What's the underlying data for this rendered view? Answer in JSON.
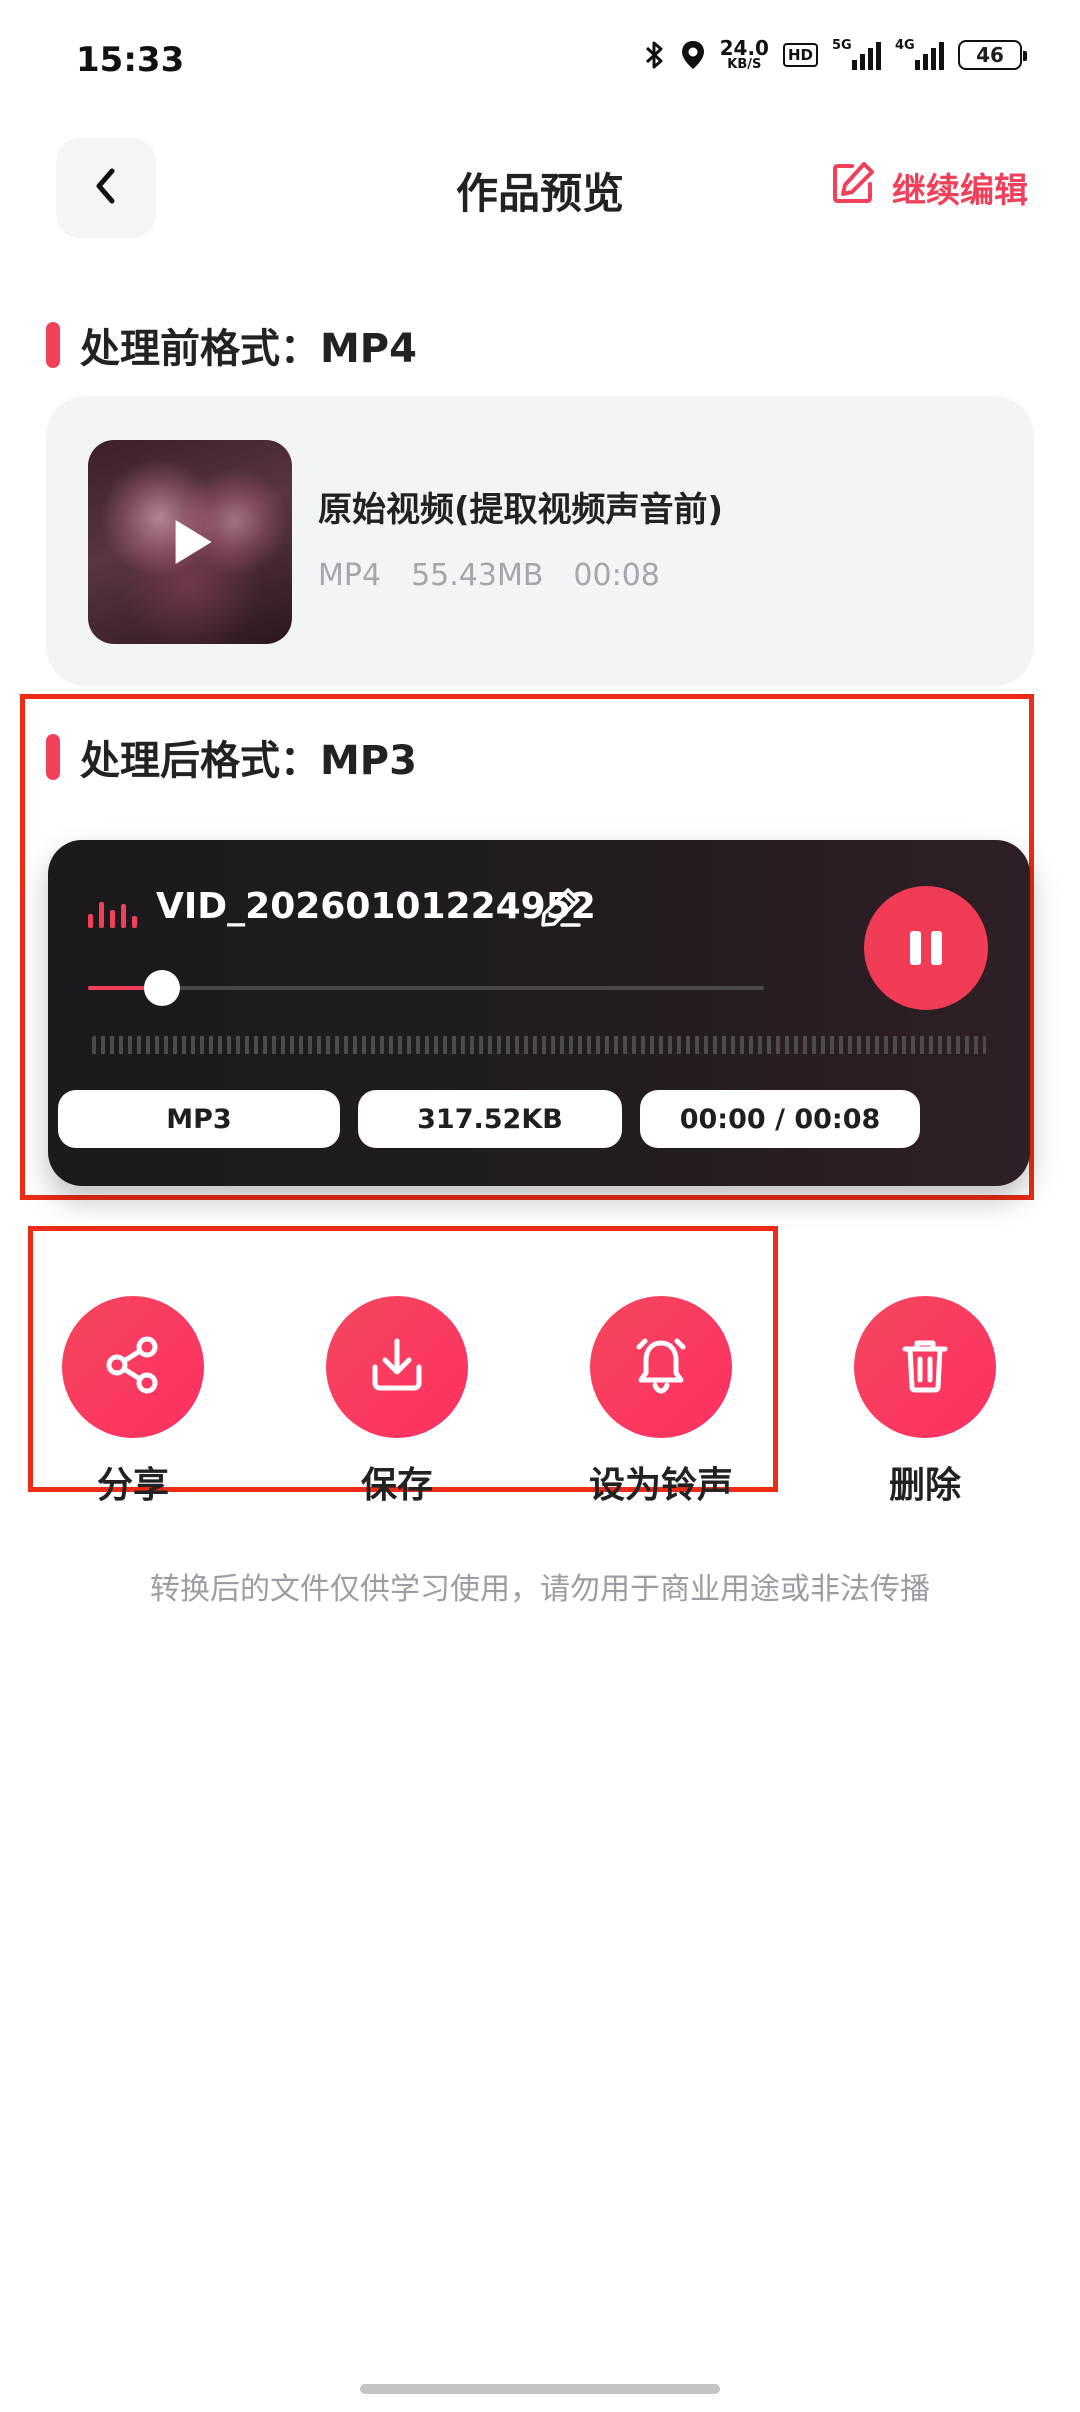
{
  "status_bar": {
    "time": "15:33",
    "net_speed_value": "24.0",
    "net_speed_unit": "KB/S",
    "hd_label": "HD",
    "signal1_label": "5G",
    "signal2_label": "4G",
    "battery": "46"
  },
  "header": {
    "title": "作品预览",
    "edit_label": "继续编辑"
  },
  "before": {
    "section_title": "处理前格式：MP4",
    "file_title": "原始视频(提取视频声音前)",
    "format": "MP4",
    "size": "55.43MB",
    "duration": "00:08"
  },
  "after": {
    "section_title": "处理后格式：MP3",
    "file_name": "VID_20260101224952",
    "progress_fraction": 0.11,
    "format": "MP3",
    "size": "317.52KB",
    "time_display": "00:00 / 00:08"
  },
  "actions": [
    {
      "label": "分享",
      "icon": "share-icon"
    },
    {
      "label": "保存",
      "icon": "download-icon"
    },
    {
      "label": "设为铃声",
      "icon": "bell-icon"
    },
    {
      "label": "删除",
      "icon": "trash-icon"
    }
  ],
  "disclaimer": "转换后的文件仅供学习使用，请勿用于商业用途或非法传播",
  "colors": {
    "accent": "#f0405a",
    "highlight_box": "#ee2b17",
    "card_bg": "#f3f4f6",
    "player_bg": "#1b1a1d"
  }
}
